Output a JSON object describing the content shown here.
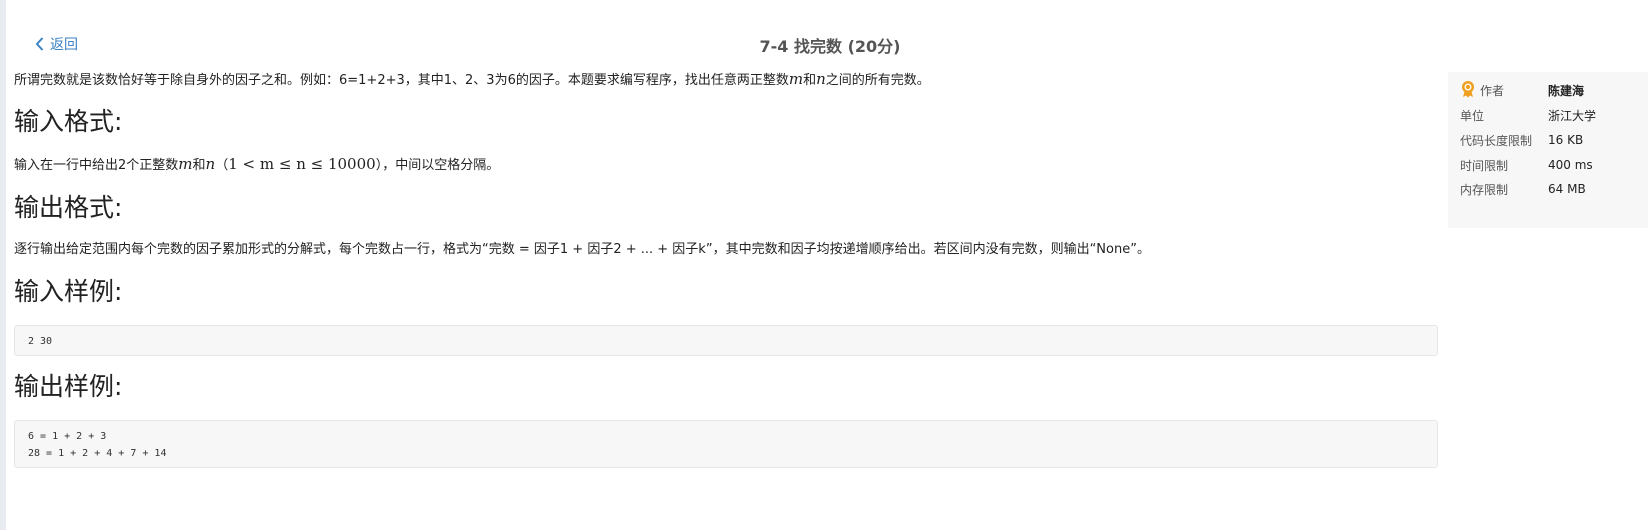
{
  "nav": {
    "back_label": "返回"
  },
  "problem": {
    "title": "7-4 找完数 (20分)",
    "description": {
      "before_m": "所谓完数就是该数恰好等于除自身外的因子之和。例如：6=1+2+3，其中1、2、3为6的因子。本题要求编写程序，找出任意两正整数",
      "var_m": "m",
      "and": "和",
      "var_n": "n",
      "after_n": "之间的所有完数。"
    },
    "input_heading": "输入格式:",
    "input_format": {
      "before": "输入在一行中给出2个正整数",
      "var_m": "m",
      "and": "和",
      "var_n": "n",
      "open_paren": "（",
      "constraint": "1 < m ≤ n ≤ 10000",
      "after": "），中间以空格分隔。"
    },
    "output_heading": "输出格式:",
    "output_format": "逐行输出给定范围内每个完数的因子累加形式的分解式，每个完数占一行，格式为“完数 = 因子1 + 因子2 + ... + 因子k”，其中完数和因子均按递增顺序给出。若区间内没有完数，则输出“None”。",
    "sample_input_heading": "输入样例:",
    "sample_input": [
      "2 30"
    ],
    "sample_output_heading": "输出样例:",
    "sample_output": [
      "6 = 1 + 2 + 3",
      "28 = 1 + 2 + 4 + 7 + 14"
    ]
  },
  "info_panel": {
    "author_label": "作者",
    "author": "陈建海",
    "unit_label": "单位",
    "unit": "浙江大学",
    "code_limit_label": "代码长度限制",
    "code_limit": "16 KB",
    "time_limit_label": "时间限制",
    "time_limit": "400 ms",
    "memory_limit_label": "内存限制",
    "memory_limit": "64 MB",
    "colors": {
      "award_icon": "#f0a020"
    }
  },
  "colors": {
    "link": "#3b82c4",
    "code_bg": "#f7f7f7",
    "panel_bg": "#f7f7f7"
  }
}
